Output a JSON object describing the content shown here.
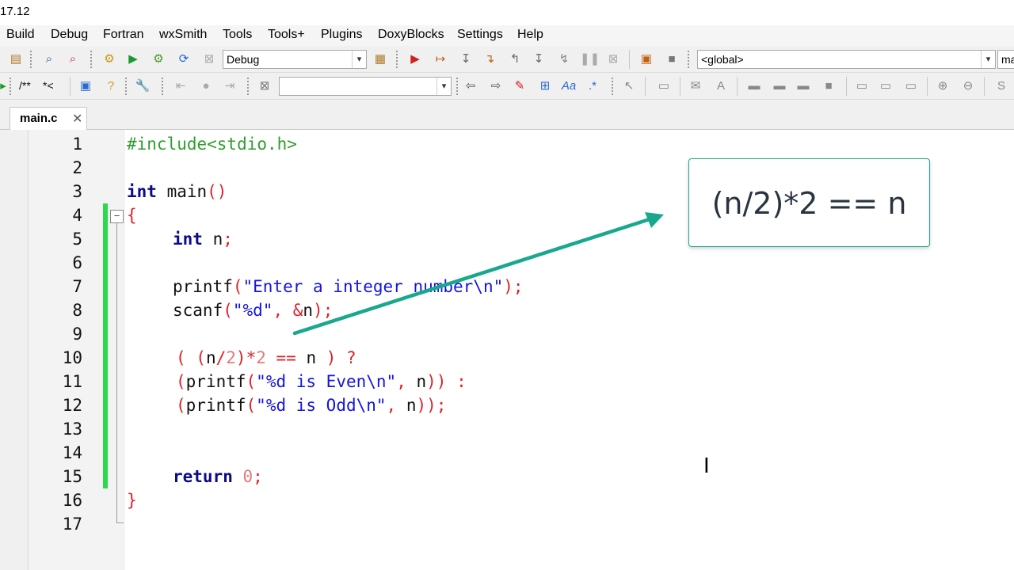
{
  "window": {
    "title_fragment": "17.12"
  },
  "menu": [
    "Build",
    "Debug",
    "Fortran",
    "wxSmith",
    "Tools",
    "Tools+",
    "Plugins",
    "DoxyBlocks",
    "Settings",
    "Help"
  ],
  "toolbar": {
    "build_target": "Debug",
    "scope_combo": "<global>",
    "symbol_combo": "ma",
    "comment_block": "/**",
    "comment_line": "*<",
    "search_combo": ""
  },
  "tabs": [
    {
      "label": "main.c",
      "close": "✕"
    }
  ],
  "editor": {
    "line_numbers": [
      "1",
      "2",
      "3",
      "4",
      "5",
      "6",
      "7",
      "8",
      "9",
      "10",
      "11",
      "12",
      "13",
      "14",
      "15",
      "16",
      "17"
    ],
    "code": {
      "l1": "#include<stdio.h>",
      "l3_kw": "int",
      "l3_rest": " main",
      "l3_p": "()",
      "l4": "{",
      "l5_kw": "int",
      "l5_rest": " n",
      "l5_p": ";",
      "l7_fn": "printf",
      "l7_p1": "(",
      "l7_str": "\"Enter a integer number\\n\"",
      "l7_p2": ");",
      "l8_fn": "scanf",
      "l8_p1": "(",
      "l8_str": "\"%d\"",
      "l8_p2": ", &",
      "l8_v": "n",
      "l8_p3": ");",
      "l10_p1": "( ",
      "l10_p2": "(",
      "l10_v1": "n",
      "l10_p3": "/",
      "l10_num": "2",
      "l10_p4": ")*",
      "l10_num2": "2",
      "l10_op": " == ",
      "l10_v2": "n",
      "l10_p5": " ) ?",
      "l11_p1": "(",
      "l11_fn": "printf",
      "l11_p2": "(",
      "l11_str": "\"%d is Even\\n\"",
      "l11_p3": ", ",
      "l11_v": "n",
      "l11_p4": ")) :",
      "l12_p1": "(",
      "l12_fn": "printf",
      "l12_p2": "(",
      "l12_str": "\"%d is Odd\\n\"",
      "l12_p3": ", ",
      "l12_v": "n",
      "l12_p4": "));",
      "l15_kw": "return",
      "l15_num": " 0",
      "l15_p": ";",
      "l16": "}"
    }
  },
  "callout": {
    "text": "(n/2)*2 == n"
  },
  "colors": {
    "accent": "#1aa88d",
    "changebar": "#2ad94c",
    "keyword": "#0a0a8a",
    "string": "#1414e0",
    "operator": "#e0202a"
  }
}
